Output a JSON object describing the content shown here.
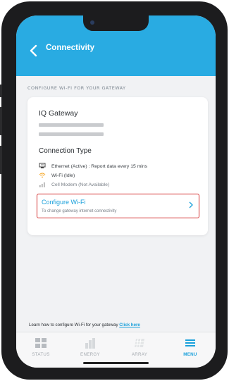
{
  "header": {
    "title": "Connectivity"
  },
  "section_label": "CONFIGURE WI-FI FOR YOUR GATEWAY",
  "gateway": {
    "name": "IQ Gateway"
  },
  "connection": {
    "title": "Connection Type",
    "items": [
      {
        "icon": "ethernet-icon",
        "label": "Ethernet (Active) : Report data every 15 mins"
      },
      {
        "icon": "wifi-icon",
        "label": "Wi-Fi (Idle)"
      },
      {
        "icon": "cell-signal-icon",
        "label": "Cell Modem (Not Available)"
      }
    ]
  },
  "configure": {
    "title": "Configure Wi-Fi",
    "subtitle": "To change gateway internet connectivity"
  },
  "help": {
    "text": "Learn how to configure Wi-Fi for your gateway",
    "link": "Click here"
  },
  "tabs": [
    {
      "label": "STATUS",
      "icon": "grid-icon"
    },
    {
      "label": "ENERGY",
      "icon": "bar-chart-icon"
    },
    {
      "label": "ARRAY",
      "icon": "solar-panel-icon"
    },
    {
      "label": "MENU",
      "icon": "menu-icon",
      "active": true
    }
  ],
  "colors": {
    "brand": "#29abe2",
    "link": "#1aa0db",
    "highlight_border": "#d32f2f"
  }
}
